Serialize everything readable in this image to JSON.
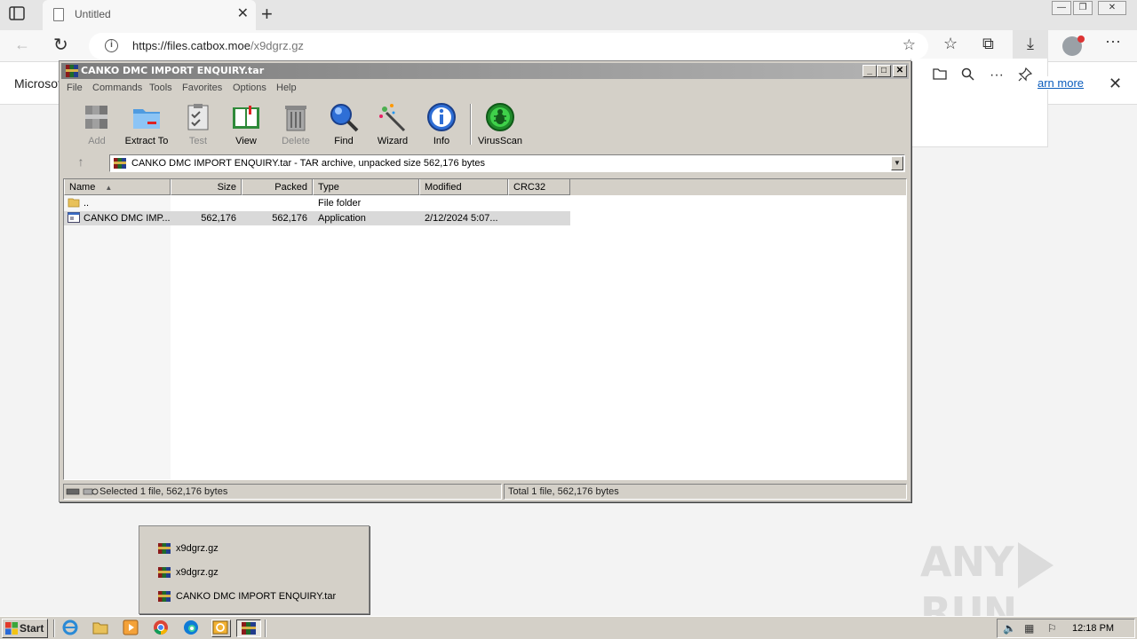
{
  "browser": {
    "tab_title": "Untitled",
    "new_tab": "+",
    "url_host": "https://files.catbox.moe",
    "url_path": "/x9dgrz.gz",
    "info_text": "Microsof",
    "learn_more": "arn more"
  },
  "rar": {
    "title": "CANKO DMC IMPORT ENQUIRY.tar",
    "menu": [
      "File",
      "Commands",
      "Tools",
      "Favorites",
      "Options",
      "Help"
    ],
    "tools": [
      {
        "label": "Add",
        "icon": "add-archive-icon",
        "enabled": false
      },
      {
        "label": "Extract To",
        "icon": "extract-folder-icon",
        "enabled": true
      },
      {
        "label": "Test",
        "icon": "test-clipboard-icon",
        "enabled": false
      },
      {
        "label": "View",
        "icon": "view-book-icon",
        "enabled": true
      },
      {
        "label": "Delete",
        "icon": "trash-icon",
        "enabled": false
      },
      {
        "label": "Find",
        "icon": "magnifier-icon",
        "enabled": true
      },
      {
        "label": "Wizard",
        "icon": "wand-icon",
        "enabled": true
      },
      {
        "label": "Info",
        "icon": "info-icon",
        "enabled": true
      },
      {
        "label": "VirusScan",
        "icon": "bug-icon",
        "enabled": true
      }
    ],
    "path": "CANKO DMC IMPORT ENQUIRY.tar - TAR archive, unpacked size 562,176 bytes",
    "columns": [
      "Name",
      "Size",
      "Packed",
      "Type",
      "Modified",
      "CRC32"
    ],
    "rows": [
      {
        "name": "..",
        "size": "",
        "packed": "",
        "type": "File folder",
        "modified": "",
        "crc": ""
      },
      {
        "name": "CANKO DMC IMP...",
        "size": "562,176",
        "packed": "562,176",
        "type": "Application",
        "modified": "2/12/2024 5:07...",
        "crc": ""
      }
    ],
    "status_left": "Selected 1 file, 562,176 bytes",
    "status_right": "Total 1 file, 562,176 bytes"
  },
  "jumplist": [
    "x9dgrz.gz",
    "x9dgrz.gz",
    "CANKO DMC IMPORT ENQUIRY.tar"
  ],
  "watermark": {
    "left": "ANY",
    "right": "RUN"
  },
  "taskbar": {
    "start": "Start",
    "clock": "12:18 PM"
  }
}
